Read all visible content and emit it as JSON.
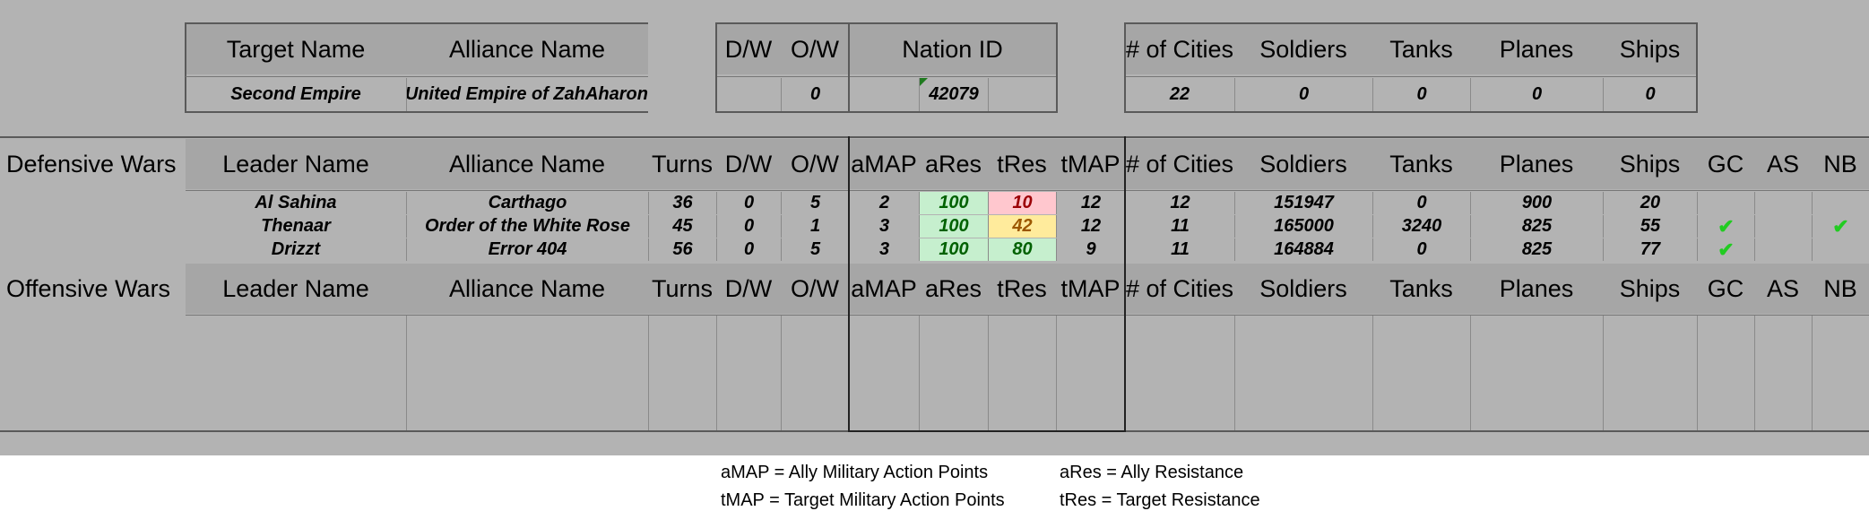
{
  "target": {
    "headers": {
      "target_name": "Target Name",
      "alliance_name": "Alliance Name",
      "dw": "D/W",
      "ow": "O/W",
      "nation_id": "Nation ID",
      "cities": "# of Cities",
      "soldiers": "Soldiers",
      "tanks": "Tanks",
      "planes": "Planes",
      "ships": "Ships"
    },
    "values": {
      "target_name": "Second Empire",
      "alliance_name": "e United Empire of ZahAharon",
      "dw": "",
      "ow": "0",
      "nation_id": "42079",
      "cities": "22",
      "soldiers": "0",
      "tanks": "0",
      "planes": "0",
      "ships": "0"
    }
  },
  "defensive": {
    "section_label": "Defensive Wars",
    "headers": {
      "leader": "Leader Name",
      "alliance": "Alliance Name",
      "turns": "Turns",
      "dw": "D/W",
      "ow": "O/W",
      "amap": "aMAP",
      "ares": "aRes",
      "tres": "tRes",
      "tmap": "tMAP",
      "cities": "# of Cities",
      "soldiers": "Soldiers",
      "tanks": "Tanks",
      "planes": "Planes",
      "ships": "Ships",
      "gc": "GC",
      "as": "AS",
      "nb": "NB"
    },
    "rows": [
      {
        "leader": "Al Sahina",
        "alliance": "Carthago",
        "turns": "36",
        "dw": "0",
        "ow": "5",
        "amap": "2",
        "ares": "100",
        "tres": "10",
        "tmap": "12",
        "cities": "12",
        "soldiers": "151947",
        "tanks": "0",
        "planes": "900",
        "ships": "20",
        "gc": "",
        "as": "",
        "nb": ""
      },
      {
        "leader": "Thenaar",
        "alliance": "Order of the White Rose",
        "turns": "45",
        "dw": "0",
        "ow": "1",
        "amap": "3",
        "ares": "100",
        "tres": "42",
        "tmap": "12",
        "cities": "11",
        "soldiers": "165000",
        "tanks": "3240",
        "planes": "825",
        "ships": "55",
        "gc": "✔",
        "as": "",
        "nb": "✔"
      },
      {
        "leader": "Drizzt",
        "alliance": "Error 404",
        "turns": "56",
        "dw": "0",
        "ow": "5",
        "amap": "3",
        "ares": "100",
        "tres": "80",
        "tmap": "9",
        "cities": "11",
        "soldiers": "164884",
        "tanks": "0",
        "planes": "825",
        "ships": "77",
        "gc": "✔",
        "as": "",
        "nb": ""
      }
    ]
  },
  "offensive": {
    "section_label": "Offensive Wars",
    "headers": {
      "leader": "Leader Name",
      "alliance": "Alliance Name",
      "turns": "Turns",
      "dw": "D/W",
      "ow": "O/W",
      "amap": "aMAP",
      "ares": "aRes",
      "tres": "tRes",
      "tmap": "tMAP",
      "cities": "# of Cities",
      "soldiers": "Soldiers",
      "tanks": "Tanks",
      "planes": "Planes",
      "ships": "Ships",
      "gc": "GC",
      "as": "AS",
      "nb": "NB"
    }
  },
  "legend": {
    "amap": "aMAP = Ally Military Action Points",
    "tmap": "tMAP = Target Military Action Points",
    "ares": "aRes = Ally Resistance",
    "tres": "tRes = Target Resistance"
  },
  "colors": {
    "sheet_bg": "#b3b3b3",
    "header_bg": "#a6a6a6",
    "good": "#c6efce",
    "bad": "#ffc7ce",
    "neutral": "#ffeb9c",
    "check": "#22cc22"
  }
}
